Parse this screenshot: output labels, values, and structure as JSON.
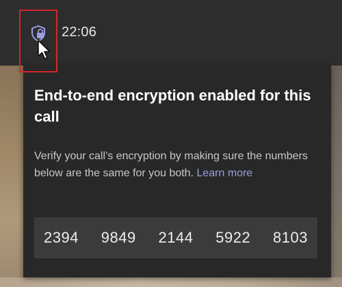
{
  "header": {
    "call_time": "22:06"
  },
  "icons": {
    "shield": "shield-lock-icon",
    "cursor": "mouse-pointer-icon"
  },
  "popover": {
    "title": "End-to-end encryption enabled for this call",
    "description": "Verify your call’s encryption by making sure the numbers below are the same for you both.",
    "learn_more": "Learn more",
    "codes": [
      "2394",
      "9849",
      "2144",
      "5922",
      "8103"
    ]
  },
  "colors": {
    "highlight_border": "#d6262b",
    "shield_accent": "#9b9ee0",
    "link": "#9b9ee0",
    "panel_bg": "#282828",
    "code_bg": "#3b3b3b"
  }
}
